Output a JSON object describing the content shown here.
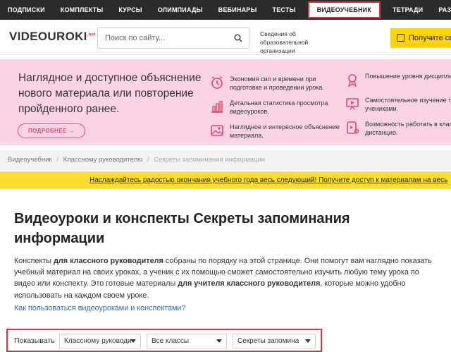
{
  "topnav": {
    "items": [
      "ПОДПИСКИ",
      "КОМПЛЕКТЫ",
      "КУРСЫ",
      "ОЛИМПИАДЫ",
      "ВЕБИНАРЫ",
      "ТЕСТЫ",
      "ВИДЕОУЧЕБНИК",
      "ТЕТРАДИ",
      "РАЗР"
    ]
  },
  "header": {
    "logo": {
      "prefix": "VI",
      "accent": "DEOUROKI",
      "suffix": ".net",
      "accent_color": "#d9363e"
    },
    "search_placeholder": "Поиск по сайту...",
    "org_info": "Сведения об образовательной организации",
    "get_button": "Получите сви"
  },
  "promo": {
    "text": "Наглядное и доступное объяснение нового материала или повторение пройденного ранее.",
    "more_button": "ПОДРОБНЕЕ →",
    "accent_color": "#e8456b",
    "features": [
      {
        "icon": "alarm-clock-icon",
        "text": "Экономия сил и времени при подготовке и проведении урока."
      },
      {
        "icon": "bar-chart-icon",
        "text": "Детальная статистика просмотра видеоуроков."
      },
      {
        "icon": "image-icon",
        "text": "Наглядное и интересное объяснение материала."
      },
      {
        "icon": "medal-icon",
        "text": "Повышение уровня дисциплины."
      },
      {
        "icon": "video-board-icon",
        "text": "Самостоятельное изучение темы учениками."
      },
      {
        "icon": "online-learning-icon",
        "text": "Возможность работать в классе и дистанцио."
      }
    ]
  },
  "breadcrumb": {
    "items": [
      "Видеоучебник",
      "Классному руководителю"
    ],
    "current": "Секреты запоминания информации"
  },
  "notice": "Наслаждайтесь радостью окончания учебного года весь следующий! Получите доступ к материалам на весь",
  "main": {
    "title": "Видеоуроки и конспекты Секреты запоминания информации",
    "desc_1": "Конспекты ",
    "desc_bold_1": "для классного руководителя",
    "desc_2": " собраны по порядку на этой странице. Они помогут вам наглядно показать учебный материал на своих уроках, а ученик с их помощью сможет самостоятельно изучить любую тему урока по видео или конспекту. Это готовые материалы ",
    "desc_bold_2": "для учителя классного руководителя",
    "desc_3": ", которые можно удобно использовать на каждом своем уроке.",
    "howto_link": "Как пользоваться видеоуроками и конспектами?"
  },
  "filters": {
    "label": "Показывать",
    "subject": "Классному руководи",
    "grade": "Все классы",
    "topic": "Секреты запомина"
  }
}
